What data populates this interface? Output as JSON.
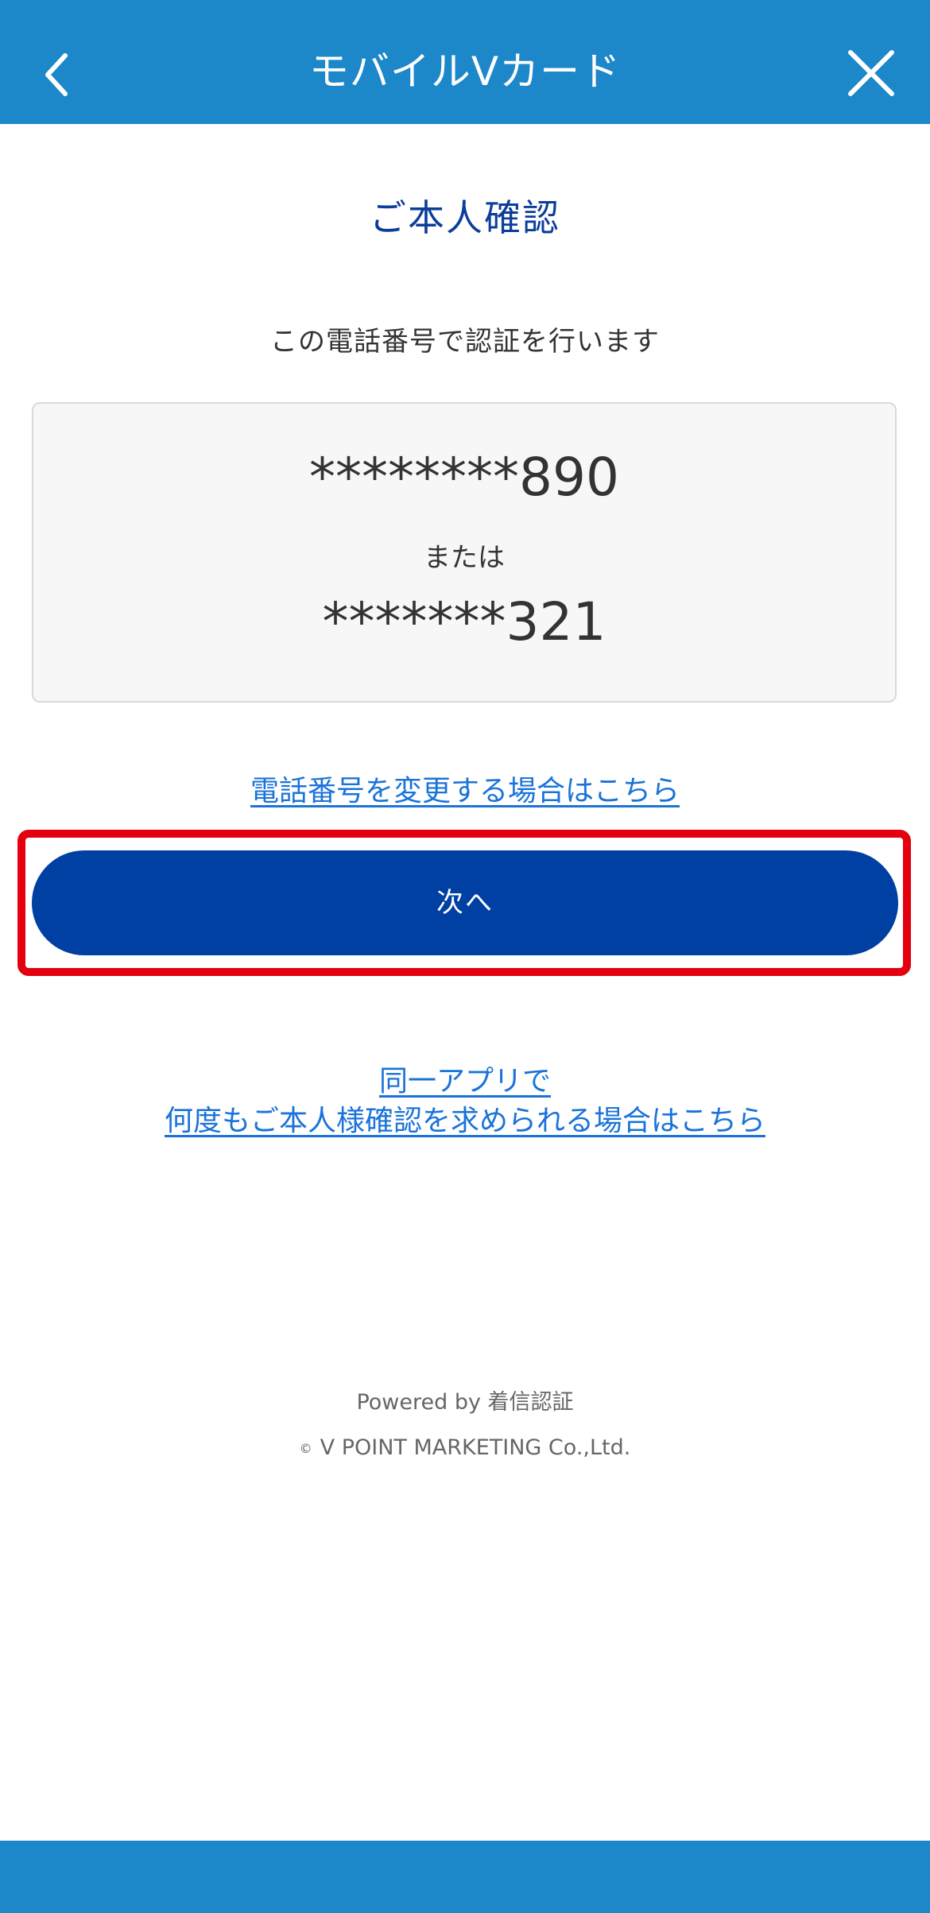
{
  "header": {
    "title": "モバイルVカード",
    "back_icon": "chevron-left-icon",
    "close_icon": "close-icon",
    "background_color": "#1c87c9"
  },
  "main": {
    "page_title": "ご本人確認",
    "lead_text": "この電話番号で認証を行います",
    "phone_numbers": [
      "********890",
      "*******321"
    ],
    "or_text": "または",
    "change_phone_link": "電話番号を変更する場合はこちら",
    "next_button_label": "次へ",
    "repeat_link_line1": "同一アプリで",
    "repeat_link_line2": "何度もご本人様確認を求められる場合はこちら",
    "button_color": "#0040a3",
    "link_color": "#1a73d9",
    "highlight_color": "#e5000f"
  },
  "footer": {
    "powered_by": "Powered by 着信認証",
    "copyright_symbol": "©",
    "copyright_text": "V POINT MARKETING Co.,Ltd."
  }
}
